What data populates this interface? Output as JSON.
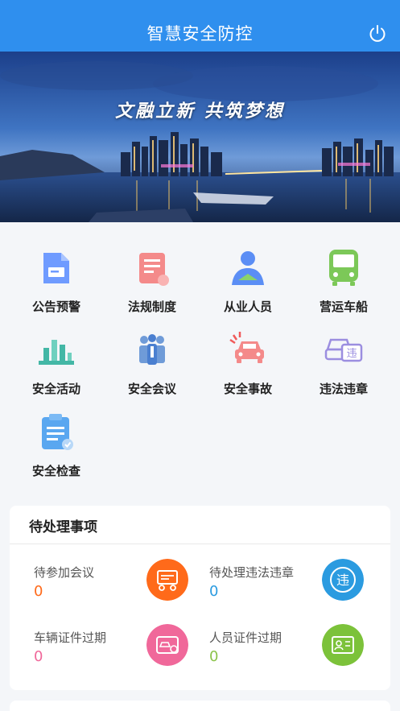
{
  "header": {
    "title": "智慧安全防控",
    "power_icon": "power-icon",
    "bg_color": "#2f8fee"
  },
  "banner": {
    "slogan": "文融立新  共筑梦想"
  },
  "menu": {
    "items": [
      {
        "label": "公告预警",
        "icon": "announcement-icon"
      },
      {
        "label": "法规制度",
        "icon": "regulation-icon"
      },
      {
        "label": "从业人员",
        "icon": "staff-icon"
      },
      {
        "label": "营运车船",
        "icon": "bus-icon"
      },
      {
        "label": "安全活动",
        "icon": "activity-chart-icon"
      },
      {
        "label": "安全会议",
        "icon": "meeting-icon"
      },
      {
        "label": "安全事故",
        "icon": "accident-car-icon"
      },
      {
        "label": "违法违章",
        "icon": "violation-car-icon"
      },
      {
        "label": "安全检查",
        "icon": "clipboard-check-icon"
      }
    ]
  },
  "todo": {
    "title": "待处理事项",
    "items": [
      {
        "label": "待参加会议",
        "value": "0",
        "value_color": "#ff6a1a",
        "icon_color": "#ff6a1a",
        "icon": "meeting-badge-icon"
      },
      {
        "label": "待处理违法违章",
        "value": "0",
        "value_color": "#2b9be0",
        "icon_color": "#2b9be0",
        "icon": "violation-badge-icon"
      },
      {
        "label": "车辆证件过期",
        "value": "0",
        "value_color": "#f0689a",
        "icon_color": "#f0689a",
        "icon": "vehicle-license-icon"
      },
      {
        "label": "人员证件过期",
        "value": "0",
        "value_color": "#8bc34a",
        "icon_color": "#7cc23a",
        "icon": "personnel-license-icon"
      }
    ]
  }
}
